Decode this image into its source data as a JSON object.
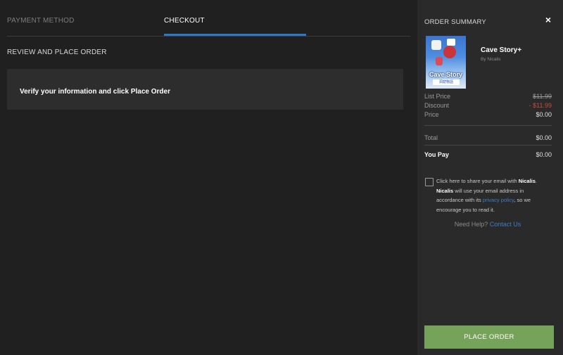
{
  "tabs": {
    "payment_method": "PAYMENT METHOD",
    "checkout": "CHECKOUT"
  },
  "main": {
    "section_title": "REVIEW AND PLACE ORDER",
    "verify_message": "Verify your information and click Place Order"
  },
  "summary": {
    "title": "ORDER SUMMARY",
    "close_icon": "×",
    "game": {
      "title": "Cave Story+",
      "publisher": "By Nicalis",
      "cover_logo": "Cave Story",
      "cover_sub": "洞窟物語"
    },
    "list_price_label": "List Price",
    "list_price_value": "$11.99",
    "discount_label": "Discount",
    "discount_value": "- $11.99",
    "price_label": "Price",
    "price_value": "$0.00",
    "total_label": "Total",
    "total_value": "$0.00",
    "you_pay_label": "You Pay",
    "you_pay_value": "$0.00",
    "consent": {
      "part1": "Click here to share your email with ",
      "publisher1": "Nicalis",
      "part2": ". ",
      "publisher2": "Nicalis",
      "part3": " will use your email address in accordance with its ",
      "privacy_link": "privacy policy",
      "part4": ", so we encourage you to read it."
    },
    "help_text": "Need Help? ",
    "contact_link": "Contact Us",
    "place_order_label": "PLACE ORDER"
  },
  "colors": {
    "accent_blue": "#2a78c8",
    "place_order_green": "#76a35a",
    "discount_red": "#c94a3e"
  }
}
